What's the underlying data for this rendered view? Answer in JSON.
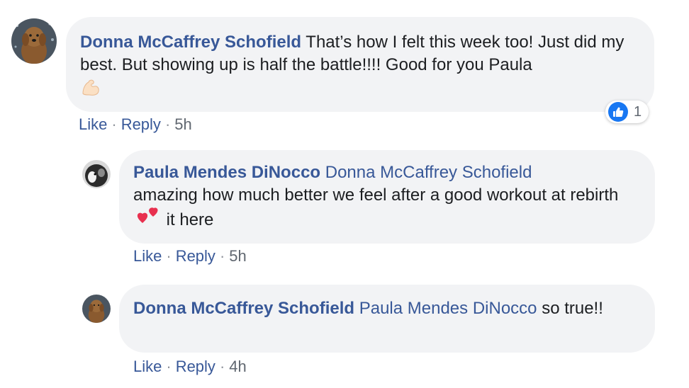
{
  "comments": [
    {
      "author": "Donna McCaffrey Schofield",
      "text": "That’s how I felt this week too! Just did my best. But showing up is half the battle!!!! Good for you Paula",
      "emoji": "flexed-biceps",
      "actions": {
        "like": "Like",
        "reply": "Reply",
        "time": "5h"
      },
      "reaction": {
        "type": "like",
        "count": "1"
      }
    },
    {
      "author": "Paula Mendes DiNocco",
      "mention": "Donna McCaffrey Schofield",
      "text_before": "amazing how much better we feel after a good workout at rebirth",
      "emoji": "two-hearts",
      "text_after": "it here",
      "actions": {
        "like": "Like",
        "reply": "Reply",
        "time": "5h"
      }
    },
    {
      "author": "Donna McCaffrey Schofield",
      "mention": "Paula Mendes DiNocco",
      "text": "so true!!",
      "actions": {
        "like": "Like",
        "reply": "Reply",
        "time": "4h"
      }
    }
  ],
  "colors": {
    "link": "#385898",
    "bubble": "#f2f3f5",
    "like_blue": "#1877f2"
  }
}
